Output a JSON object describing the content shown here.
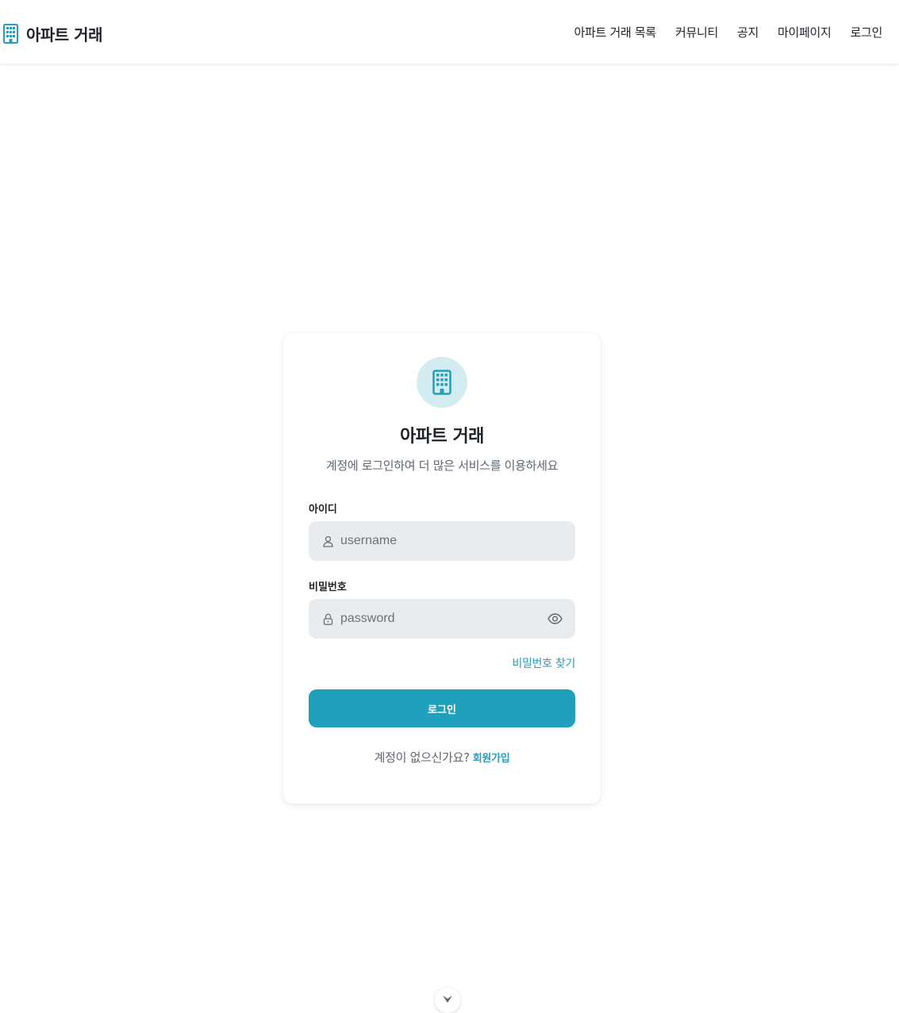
{
  "header": {
    "brand_icon": "building-icon",
    "brand_name": "아파트 거래",
    "nav": [
      {
        "label": "아파트 거래 목록"
      },
      {
        "label": "커뮤니티"
      },
      {
        "label": "공지"
      },
      {
        "label": "마이페이지"
      },
      {
        "label": "로그인"
      }
    ]
  },
  "login": {
    "logo_icon": "building-icon",
    "title": "아파트 거래",
    "subtitle": "계정에 로그인하여 더 많은 서비스를 이용하세요",
    "username": {
      "label": "아이디",
      "placeholder": "username",
      "value": "",
      "icon": "user-icon"
    },
    "password": {
      "label": "비밀번호",
      "placeholder": "password",
      "value": "",
      "icon": "lock-icon",
      "toggle_icon": "eye-icon"
    },
    "forgot_password": "비밀번호 찾기",
    "submit_label": "로그인",
    "signup_prompt": "계정이 없으신가요?",
    "signup_link": "회원가입"
  },
  "scroll_indicator": {
    "icon": "chevron-down-icon"
  },
  "colors": {
    "accent": "#21a0be",
    "accent_text": "#2b9bb8",
    "logo_bg": "#d2ecf1",
    "input_bg": "#e9ecef"
  }
}
